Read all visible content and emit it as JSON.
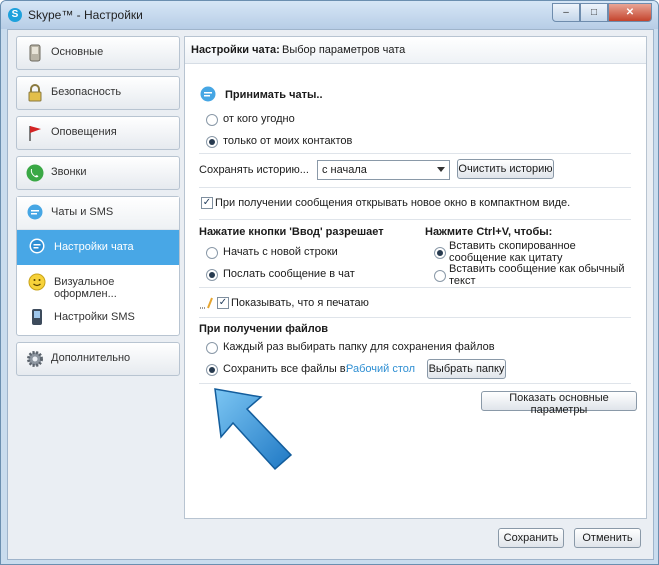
{
  "window": {
    "title": "Skype™ - Настройки",
    "min_icon": "minimize-icon",
    "max_icon": "maximize-icon",
    "close_icon": "close-icon"
  },
  "sidebar": {
    "items": [
      {
        "label": "Основные",
        "icon": "phone-device-icon"
      },
      {
        "label": "Безопасность",
        "icon": "padlock-icon"
      },
      {
        "label": "Оповещения",
        "icon": "flag-icon"
      },
      {
        "label": "Звонки",
        "icon": "phone-icon"
      }
    ],
    "chats_group": {
      "label": "Чаты и SMS",
      "icon": "chat-bubble-icon",
      "subitems": [
        {
          "label": "Настройки чата",
          "icon": "chat-bubble-icon",
          "active": true
        },
        {
          "label": "Визуальное оформлен...",
          "icon": "smiley-icon",
          "active": false
        },
        {
          "label": "Настройки SMS",
          "icon": "sms-phone-icon",
          "active": false
        }
      ]
    },
    "advanced": {
      "label": "Дополнительно",
      "icon": "gear-icon"
    }
  },
  "content": {
    "header_bold": "Настройки чата:",
    "header_rest": " Выбор параметров чата",
    "accept_title": "Принимать чаты..",
    "accept_options": [
      "от кого угодно",
      "только от моих контактов"
    ],
    "accept_selected": 1,
    "history_label": "Сохранять историю...",
    "history_value": "с начала",
    "clear_history": "Очистить историю",
    "compact_check_label": "При получении сообщения открывать новое окно в компактном виде.",
    "compact_checked": true,
    "enter_title": "Нажатие кнопки 'Ввод' разрешает",
    "enter_options": [
      "Начать с новой строки",
      "Послать сообщение в чат"
    ],
    "enter_selected": 1,
    "ctrlv_title": "Нажмите Ctrl+V, чтобы:",
    "ctrlv_options": [
      "Вставить скопированное сообщение как цитату",
      "Вставить сообщение как обычный текст"
    ],
    "ctrlv_selected": 0,
    "typing_label": "Показывать, что я печатаю",
    "typing_checked": true,
    "files_title": "При получении файлов",
    "files_options": [
      "Каждый раз выбирать папку для сохранения файлов",
      "Сохранить все файлы в:"
    ],
    "files_selected": 1,
    "save_folder": "Рабочий стол",
    "choose_folder": "Выбрать папку",
    "show_basic": "Показать основные параметры"
  },
  "footer": {
    "save": "Сохранить",
    "cancel": "Отменить"
  },
  "colors": {
    "active_item": "#48a7e6",
    "arrow": "#3a9be0",
    "link": "#2f8fd3"
  }
}
